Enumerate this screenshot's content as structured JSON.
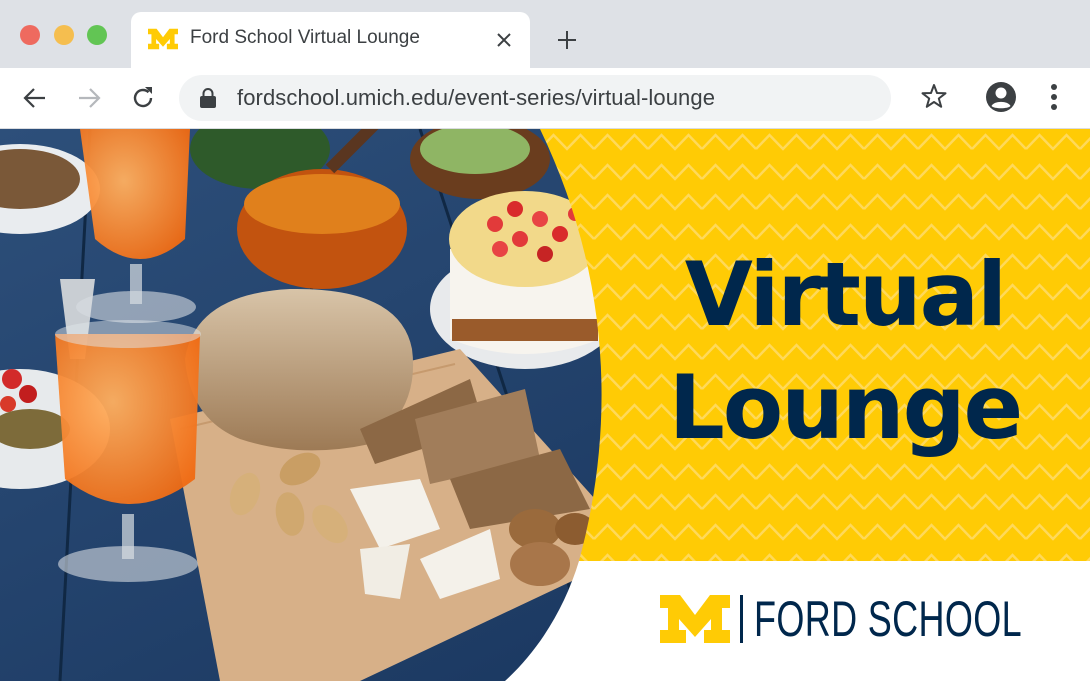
{
  "browser": {
    "tab": {
      "title": "Ford School Virtual Lounge",
      "favicon": "block-m-favicon",
      "close_icon": "close-icon"
    },
    "new_tab_icon": "plus-icon",
    "nav": {
      "back_icon": "back-arrow-icon",
      "forward_icon": "forward-arrow-icon",
      "reload_icon": "reload-icon"
    },
    "address_bar": {
      "url": "fordschool.umich.edu/event-series/virtual-lounge",
      "lock_icon": "lock-icon"
    },
    "bookmark_icon": "star-icon",
    "profile_icon": "account-circle-icon",
    "menu_icon": "more-vertical-icon"
  },
  "hero": {
    "title_line1": "Virtual",
    "title_line2": "Lounge",
    "photo": "food-table-photo",
    "pattern": "zigzag-pattern"
  },
  "logo": {
    "mark": "block-m-logo",
    "text": "FORD SCHOOL"
  },
  "colors": {
    "maize": "#ffcb05",
    "blue": "#00274c",
    "chrome_bg": "#dee1e6",
    "omnibox_bg": "#f1f3f4"
  }
}
